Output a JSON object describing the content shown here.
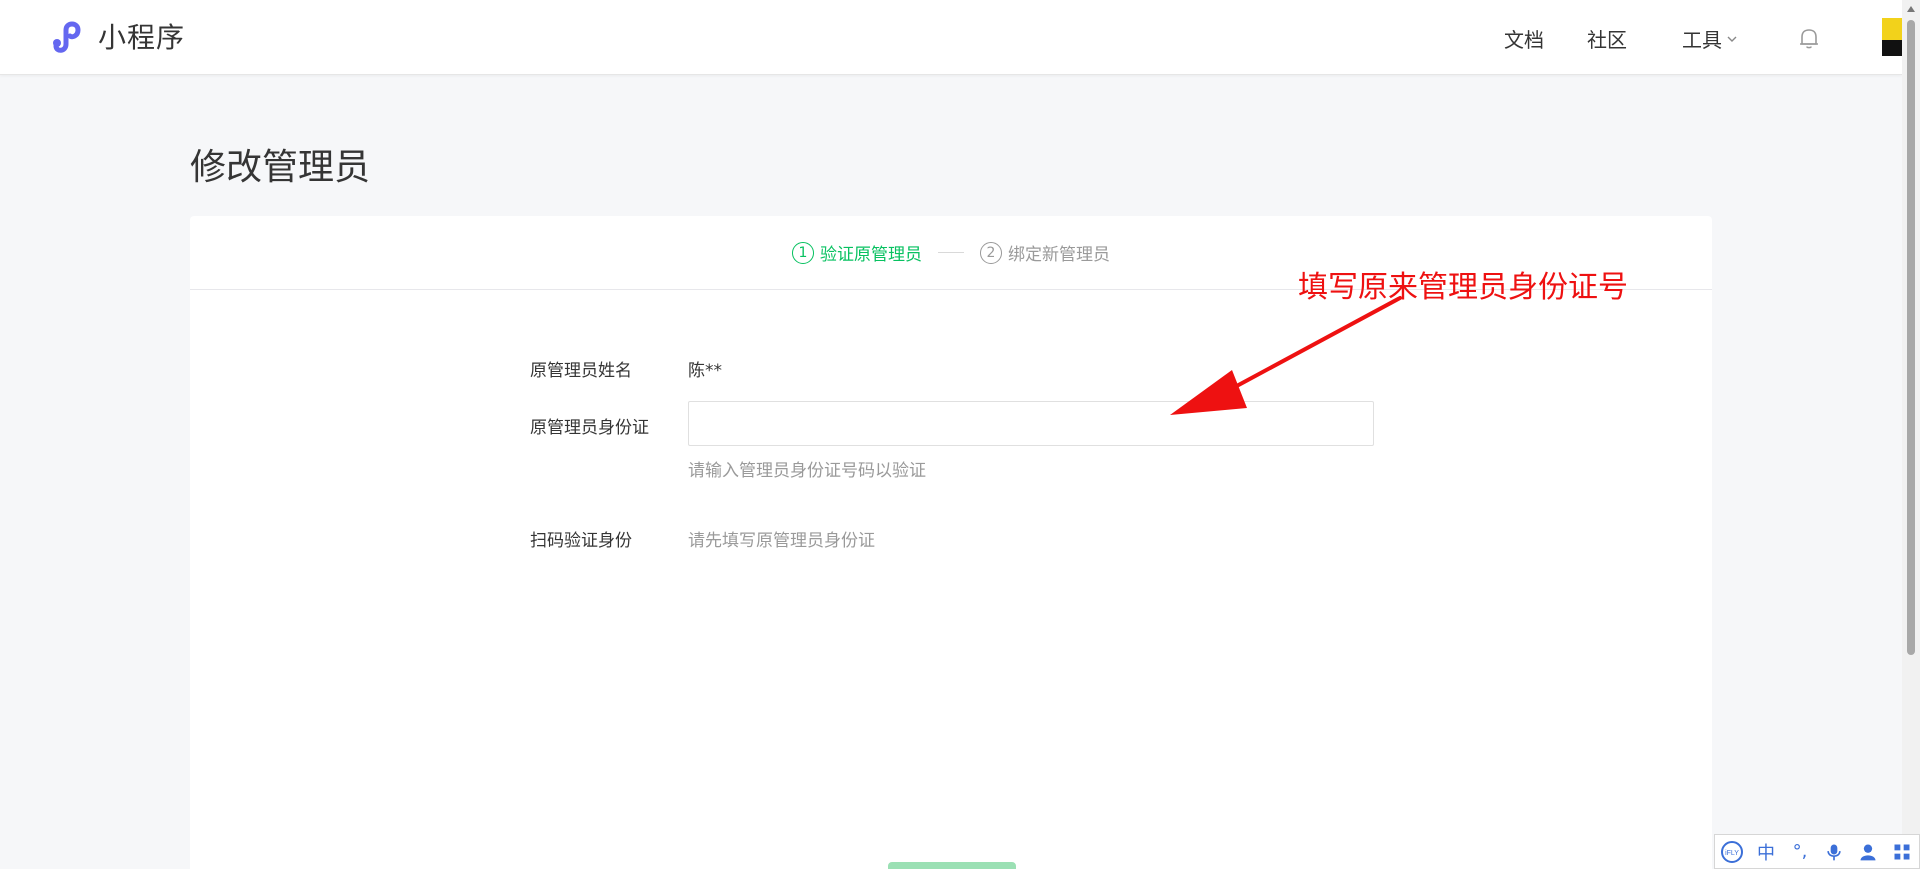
{
  "header": {
    "brand_title": "小程序",
    "nav": {
      "docs": "文档",
      "community": "社区",
      "tools": "工具"
    },
    "icons": {
      "logo": "miniprogram-logo-icon",
      "tools_dropdown": "chevron-down-icon",
      "notifications": "bell-icon",
      "avatar": "avatar",
      "avatar_menu": "avatar-menu-icon"
    }
  },
  "page": {
    "title": "修改管理员"
  },
  "steps": [
    {
      "number": "1",
      "label": "验证原管理员",
      "state": "active"
    },
    {
      "number": "2",
      "label": "绑定新管理员",
      "state": "inactive"
    }
  ],
  "form": {
    "name_label": "原管理员姓名",
    "name_value": "陈**",
    "id_label": "原管理员身份证",
    "id_value": "",
    "id_hint": "请输入管理员身份证号码以验证",
    "scan_label": "扫码验证身份",
    "scan_hint": "请先填写原管理员身份证"
  },
  "annotation": {
    "text": "填写原来管理员身份证号",
    "color": "#ee1111"
  },
  "ime_toolbar": {
    "items": [
      "iFLY",
      "中",
      "°,",
      "mic-icon",
      "user-icon",
      "grid-icon"
    ]
  },
  "colors": {
    "accent": "#07c160",
    "text": "#353535",
    "muted": "#9a9a9a",
    "brand": "#6467f0"
  }
}
